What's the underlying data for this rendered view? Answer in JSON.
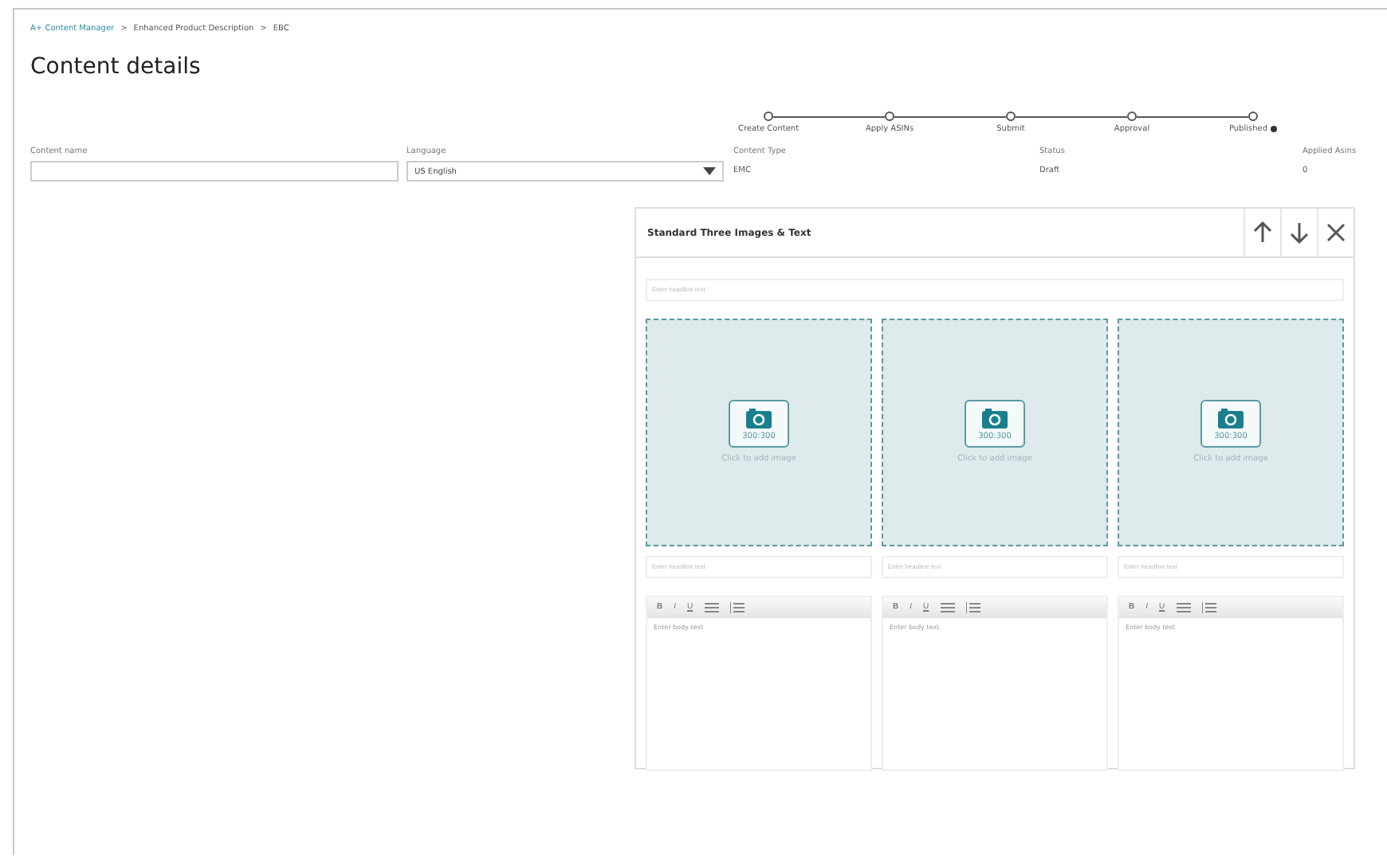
{
  "breadcrumb": [
    {
      "label": "A+ Content Manager",
      "link": true
    },
    {
      "label": "Enhanced Product Description",
      "link": false
    },
    {
      "label": "EBC",
      "link": false
    }
  ],
  "breadcrumb_separator": ">",
  "title": "Content details",
  "steps": [
    {
      "label": "Create Content",
      "current": false
    },
    {
      "label": "Apply ASINs",
      "current": false
    },
    {
      "label": "Submit",
      "current": false
    },
    {
      "label": "Approval",
      "current": false
    },
    {
      "label": "Published",
      "current": true
    }
  ],
  "fields": [
    {
      "kind": "input",
      "label": "Content name"
    },
    {
      "kind": "select",
      "label": "Language",
      "value": "US English"
    },
    {
      "kind": "text",
      "label": "Content Type",
      "value": "EMC"
    },
    {
      "kind": "text",
      "label": "Status",
      "value": "Draft"
    },
    {
      "kind": "text",
      "label": "Applied Asins",
      "value": "0"
    }
  ],
  "module": {
    "title": "Standard Three Images & Text",
    "headline_placeholder": "Enter headline text",
    "columns": [
      {
        "image_size": "300:300",
        "image_hint": "Click to add image",
        "headline_placeholder": "Enter headline text",
        "toolbar": [
          "B",
          "I",
          "U"
        ],
        "body_placeholder": "Enter body text"
      },
      {
        "image_size": "300:300",
        "image_hint": "Click to add image",
        "headline_placeholder": "Enter headline text",
        "toolbar": [
          "B",
          "I",
          "U"
        ],
        "body_placeholder": "Enter body text"
      },
      {
        "image_size": "300:300",
        "image_hint": "Click to add image",
        "headline_placeholder": "Enter headline text",
        "toolbar": [
          "B",
          "I",
          "U"
        ],
        "body_placeholder": "Enter body text"
      }
    ]
  }
}
